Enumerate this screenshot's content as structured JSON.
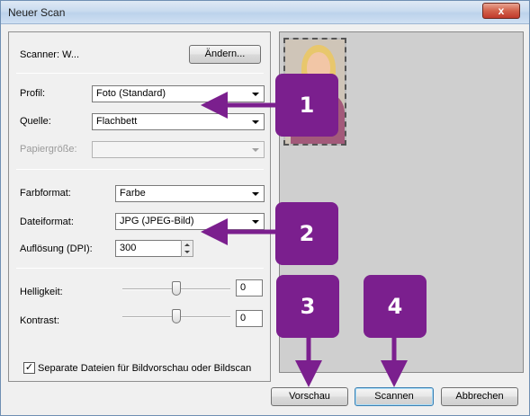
{
  "window": {
    "title": "Neuer Scan",
    "close_glyph": "x"
  },
  "scanner": {
    "label": "Scanner: W...",
    "change_button": "Ändern..."
  },
  "profile": {
    "label": "Profil:",
    "value": "Foto (Standard)"
  },
  "source": {
    "label": "Quelle:",
    "value": "Flachbett"
  },
  "paper_size": {
    "label": "Papiergröße:",
    "value": ""
  },
  "color_format": {
    "label": "Farbformat:",
    "value": "Farbe"
  },
  "file_format": {
    "label": "Dateiformat:",
    "value": "JPG (JPEG-Bild)"
  },
  "resolution": {
    "label": "Auflösung (DPI):",
    "value": "300"
  },
  "brightness": {
    "label": "Helligkeit:",
    "value": "0"
  },
  "contrast": {
    "label": "Kontrast:",
    "value": "0"
  },
  "separate_files": {
    "label": "Separate Dateien für Bildvorschau oder Bildscan",
    "checked": true
  },
  "buttons": {
    "preview": "Vorschau",
    "scan": "Scannen",
    "cancel": "Abbrechen"
  },
  "callouts": [
    "1",
    "2",
    "3",
    "4"
  ],
  "colors": {
    "callout": "#7b1f8e"
  }
}
